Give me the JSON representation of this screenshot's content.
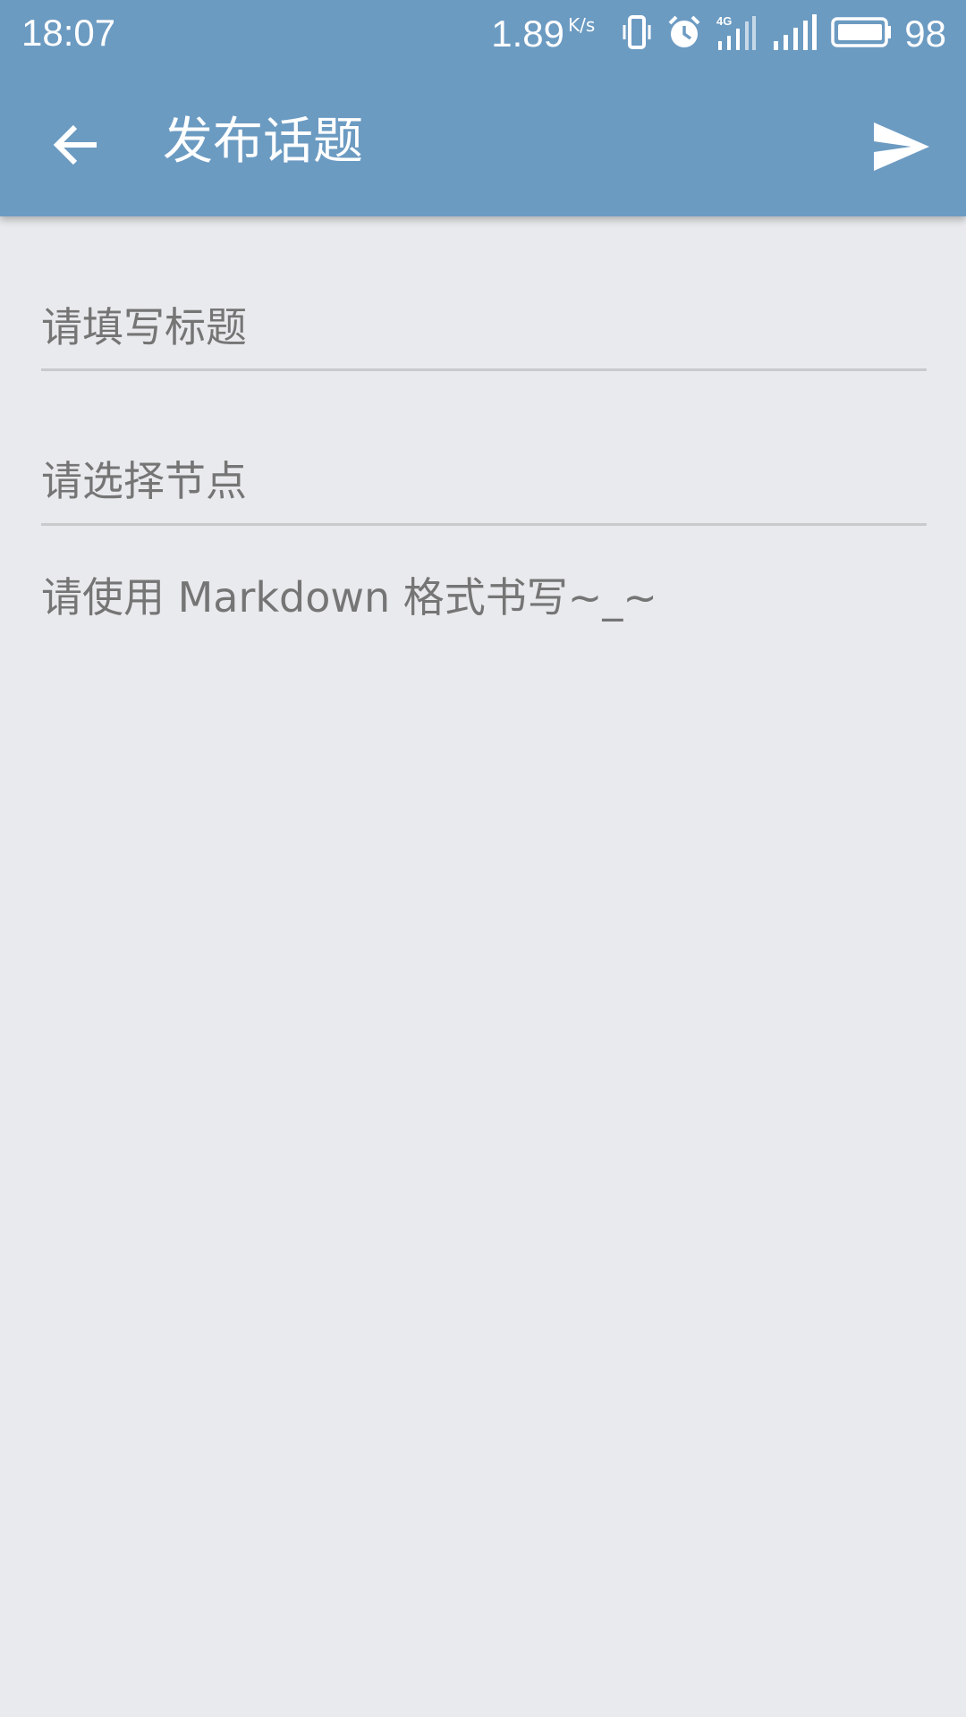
{
  "status_bar": {
    "time": "18:07",
    "net_speed": "1.89",
    "net_unit": "K/s",
    "network_type": "4G",
    "battery": "98",
    "icons": [
      "vibrate-icon",
      "alarm-icon",
      "signal-4g-icon",
      "signal-icon",
      "battery-icon"
    ]
  },
  "toolbar": {
    "title": "发布话题",
    "back_icon": "arrow-left-icon",
    "send_icon": "send-icon"
  },
  "form": {
    "title_placeholder": "请填写标题",
    "node_placeholder": "请选择节点",
    "content_placeholder": "请使用 Markdown 格式书写~_~"
  },
  "colors": {
    "app_bar": "#6c9bc2",
    "background": "#e9eaed",
    "hint_text": "#757575",
    "divider": "#c9cacc"
  }
}
